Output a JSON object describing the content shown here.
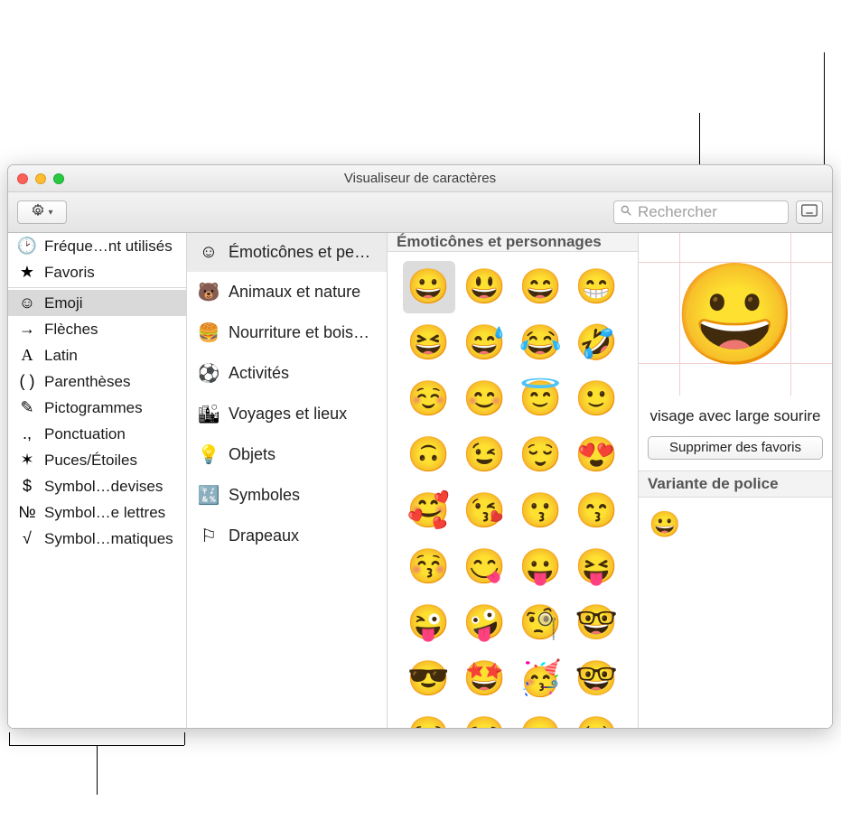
{
  "window_title": "Visualiseur de caractères",
  "search": {
    "placeholder": "Rechercher"
  },
  "sidebar": {
    "top": [
      {
        "icon": "🕑",
        "label": "Fréque…nt utilisés"
      },
      {
        "icon": "★",
        "label": "Favoris"
      }
    ],
    "categories": [
      {
        "icon": "☺",
        "label": "Emoji",
        "selected": true
      },
      {
        "icon": "→",
        "label": "Flèches"
      },
      {
        "icon": "A",
        "label": "Latin",
        "serif": true
      },
      {
        "icon": "( )",
        "label": "Parenthèses"
      },
      {
        "icon": "✎",
        "label": "Pictogrammes"
      },
      {
        "icon": ".,",
        "label": "Ponctuation"
      },
      {
        "icon": "✶",
        "label": "Puces/Étoiles"
      },
      {
        "icon": "$",
        "label": "Symbol…devises"
      },
      {
        "icon": "№",
        "label": "Symbol…e lettres"
      },
      {
        "icon": "√",
        "label": "Symbol…matiques"
      }
    ]
  },
  "subcategories": [
    {
      "icon": "☺",
      "label": "Émoticônes et per…",
      "selected": true
    },
    {
      "icon": "🐻",
      "label": "Animaux et nature"
    },
    {
      "icon": "🍔",
      "label": "Nourriture et bois…"
    },
    {
      "icon": "⚽",
      "label": "Activités"
    },
    {
      "icon": "🏙",
      "label": "Voyages et lieux"
    },
    {
      "icon": "💡",
      "label": "Objets"
    },
    {
      "icon": "🔣",
      "label": "Symboles"
    },
    {
      "icon": "⚐",
      "label": "Drapeaux"
    }
  ],
  "grid": {
    "header": "Émoticônes et personnages",
    "emoji": [
      "😀",
      "😃",
      "😄",
      "😁",
      "😆",
      "😅",
      "😂",
      "🤣",
      "☺️",
      "😊",
      "😇",
      "🙂",
      "🙃",
      "😉",
      "😌",
      "😍",
      "🥰",
      "😘",
      "😗",
      "😙",
      "😚",
      "😋",
      "😛",
      "😝",
      "😜",
      "🤪",
      "🧐",
      "🤓",
      "😎",
      "🤩",
      "🥳",
      "🤓",
      "😏",
      "😒",
      "😞",
      "😔"
    ],
    "selected_index": 0
  },
  "detail": {
    "char": "😀",
    "name": "visage avec large sourire",
    "remove_favorite_label": "Supprimer des favoris",
    "font_variant_header": "Variante de police",
    "font_variants": [
      "😀"
    ]
  }
}
